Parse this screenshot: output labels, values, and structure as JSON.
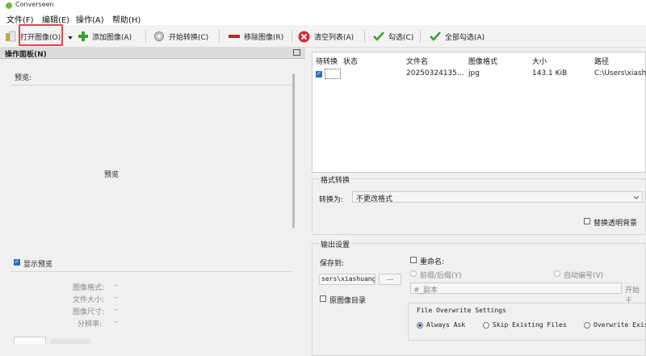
{
  "app": {
    "title": "Converseen"
  },
  "menu": {
    "file": "文件(F)",
    "edit": "编辑(E)",
    "actions": "操作(A)",
    "help": "帮助(H)"
  },
  "toolbar": {
    "open_images": "打开图像(O)",
    "add_images": "添加图像(A)",
    "start_convert": "开始转换(C)",
    "remove_image": "移除图像(R)",
    "clear_list": "清空列表(A)",
    "check": "勾选(C)",
    "check_all": "全部勾选(A)"
  },
  "left_panel": {
    "title": "操作面板(N)",
    "preview_label": "预览:",
    "preview_placeholder": "预览",
    "show_preview": "显示预览",
    "info": {
      "format_label": "图像格式:",
      "format_value": "–",
      "size_label": "文件大小:",
      "size_value": "–",
      "dimensions_label": "图像尺寸:",
      "dimensions_value": "–",
      "resolution_label": "分辨率:",
      "resolution_value": "–"
    }
  },
  "file_list": {
    "headers": [
      "待转换",
      "状态",
      "文件名",
      "图像格式",
      "大小",
      "路径"
    ],
    "rows": [
      {
        "checked": true,
        "status": "",
        "filename": "20250324135...",
        "format": "jpg",
        "size": "143.1 KiB",
        "path": "C:\\Users\\xiashu"
      }
    ]
  },
  "format_conversion": {
    "group_title": "格式转换",
    "convert_to_label": "转换为:",
    "convert_to_value": "不更改格式",
    "replace_transparent": "替换透明背景"
  },
  "output": {
    "group_title": "输出设置",
    "save_to_label": "保存到:",
    "save_path": "sers\\xiashuang",
    "browse": "...",
    "original_dir": "原图像目录",
    "rename_label": "重命名:",
    "prefix_suffix": "前缀/后缀(Y)",
    "auto_number": "自动编号(V)",
    "rename_value": "#_副本",
    "start_from": "开始于",
    "overwrite": {
      "title": "File Overwrite Settings",
      "always_ask": "Always Ask",
      "skip_existing": "Skip Existing Files",
      "overwrite_existing": "Overwrite Exis"
    }
  },
  "colors": {
    "accent": "#2f6fbf",
    "highlight": "#e0444a"
  }
}
